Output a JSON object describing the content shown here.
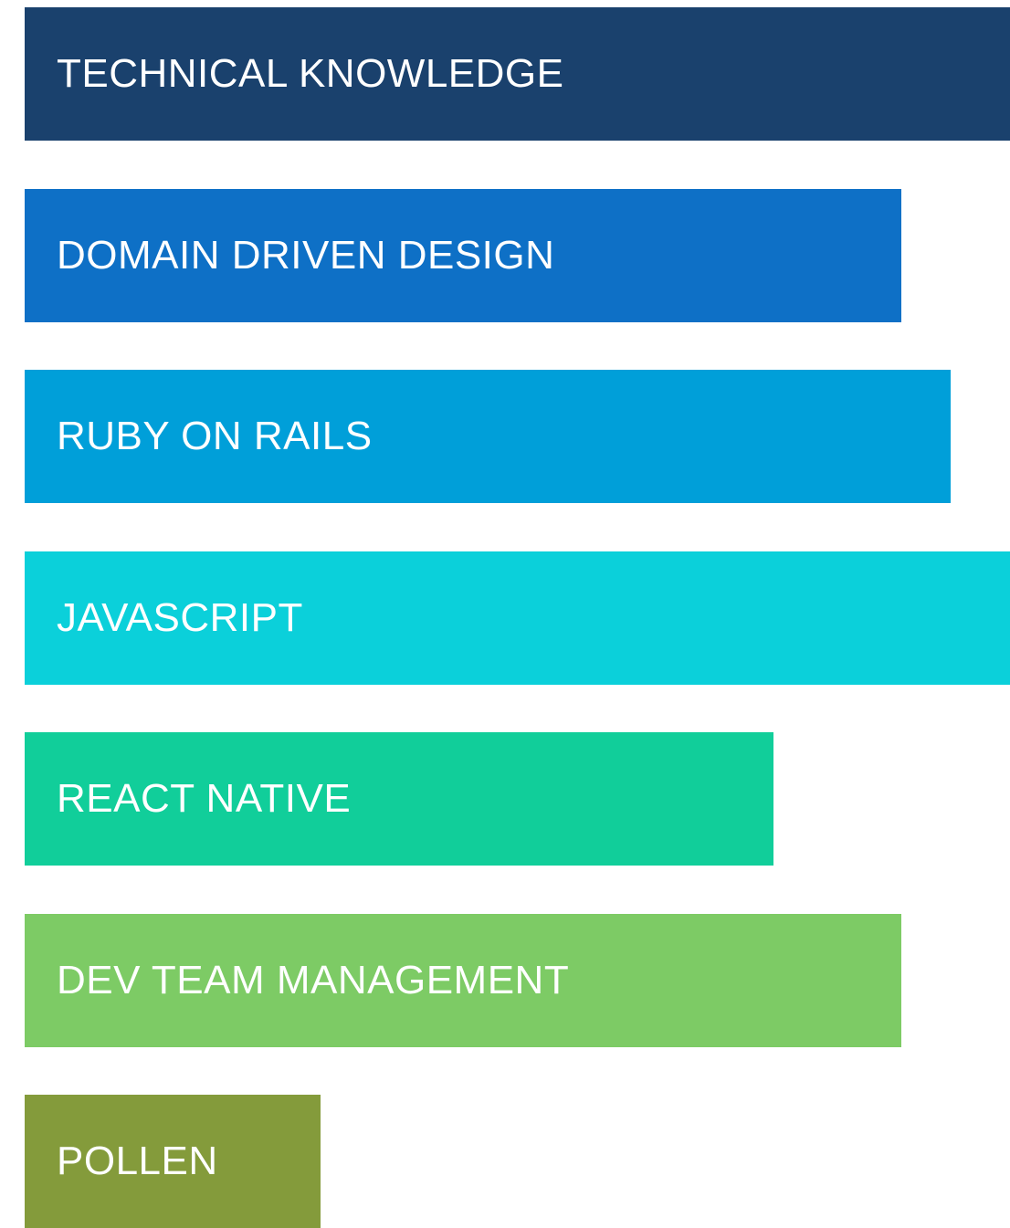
{
  "chart_data": {
    "type": "bar",
    "orientation": "horizontal",
    "categories": [
      "TECHNICAL KNOWLEDGE",
      "DOMAIN DRIVEN DESIGN",
      "RUBY ON RAILS",
      "JAVASCRIPT",
      "REACT NATIVE",
      "DEV TEAM MANAGEMENT",
      "POLLEN"
    ],
    "values": [
      100,
      89,
      94,
      100,
      76,
      89,
      30
    ],
    "colors": [
      "#1a416d",
      "#0e70c6",
      "#009fd9",
      "#0bd0da",
      "#11ce9a",
      "#7dcb65",
      "#849b3b"
    ],
    "xlim": [
      0,
      100
    ],
    "grid": false,
    "legend": "none",
    "title": "",
    "xlabel": "",
    "ylabel": ""
  }
}
